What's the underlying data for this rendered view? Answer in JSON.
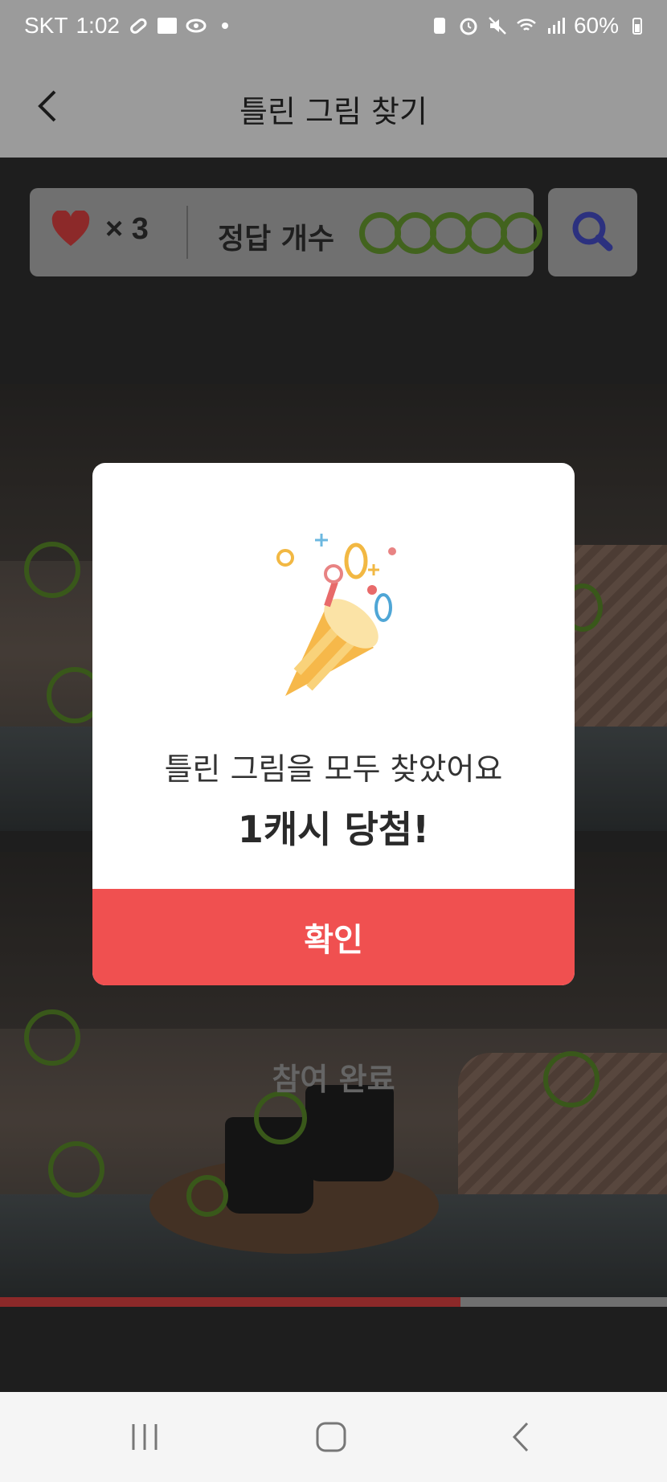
{
  "status_bar": {
    "carrier": "SKT",
    "time": "1:02",
    "battery": "60%"
  },
  "app_bar": {
    "title": "틀린 그림 찾기",
    "back_icon": "back-arrow-icon"
  },
  "game_status": {
    "lives_prefix": "×",
    "lives": "3",
    "answers_label": "정답 개수",
    "answers_found": 5,
    "answers_total": 5,
    "search_icon": "magnifier-icon"
  },
  "progress": {
    "fraction": 0.69,
    "fill_color": "#c23a3a"
  },
  "participation": {
    "label": "참여 완료"
  },
  "modal": {
    "icon": "party-popper-icon",
    "message": "틀린 그림을 모두 찾았어요",
    "prize": "1캐시 당첨!",
    "confirm_label": "확인",
    "confirm_color": "#f05050"
  },
  "nav_bar": {
    "recent_icon": "recent-apps-icon",
    "home_icon": "home-icon",
    "back_icon": "back-icon"
  }
}
